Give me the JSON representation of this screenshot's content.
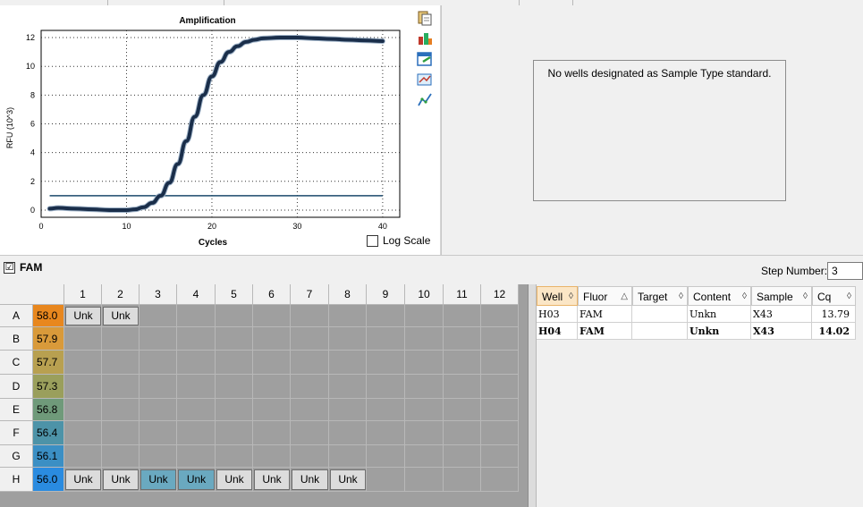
{
  "chart": {
    "title": "Amplification",
    "xlabel": "Cycles",
    "ylabel": "RFU (10^3)",
    "log_scale_label": "Log Scale"
  },
  "chart_data": {
    "type": "line",
    "title": "Amplification",
    "xlabel": "Cycles",
    "ylabel": "RFU (10^3)",
    "xlim": [
      0,
      42
    ],
    "ylim": [
      -0.5,
      12.5
    ],
    "xticks": [
      0,
      10,
      20,
      30,
      40
    ],
    "yticks": [
      0,
      2,
      4,
      6,
      8,
      10,
      12
    ],
    "grid": true,
    "threshold": 1.0,
    "series": [
      {
        "x": [
          1,
          2,
          4,
          6,
          8,
          10,
          11,
          12,
          13,
          14,
          15,
          16,
          17,
          18,
          19,
          20,
          21,
          22,
          23,
          24,
          25,
          26,
          28,
          30,
          32,
          34,
          36,
          38,
          40
        ],
        "y": [
          0.1,
          0.15,
          0.1,
          0.05,
          0.0,
          0.0,
          0.05,
          0.2,
          0.5,
          1.0,
          1.9,
          3.2,
          4.8,
          6.5,
          8.0,
          9.3,
          10.3,
          11.0,
          11.4,
          11.7,
          11.85,
          11.95,
          12.0,
          12.0,
          11.95,
          11.9,
          11.85,
          11.8,
          11.75
        ],
        "color": "#1a2e4a"
      }
    ]
  },
  "standard_curve": {
    "message": "No wells designated as Sample Type standard."
  },
  "fluor_bar": {
    "check": "☑",
    "label": "FAM",
    "step_label": "Step Number:",
    "step_value": "3"
  },
  "plate": {
    "columns": [
      "1",
      "2",
      "3",
      "4",
      "5",
      "6",
      "7",
      "8",
      "9",
      "10",
      "11",
      "12"
    ],
    "rows": [
      "A",
      "B",
      "C",
      "D",
      "E",
      "F",
      "G",
      "H"
    ],
    "gradient": [
      "58.0",
      "57.9",
      "57.7",
      "57.3",
      "56.8",
      "56.4",
      "56.1",
      "56.0"
    ],
    "gradient_colors": [
      "#e8871e",
      "#d99a3a",
      "#b8a050",
      "#9a9f5c",
      "#6f9a7a",
      "#4d93a8",
      "#3b8fc4",
      "#2a8be0"
    ],
    "wells": [
      {
        "row": 0,
        "col": 0,
        "label": "Unk",
        "highlight": false
      },
      {
        "row": 0,
        "col": 1,
        "label": "Unk",
        "highlight": false
      },
      {
        "row": 7,
        "col": 0,
        "label": "Unk",
        "highlight": false
      },
      {
        "row": 7,
        "col": 1,
        "label": "Unk",
        "highlight": false
      },
      {
        "row": 7,
        "col": 2,
        "label": "Unk",
        "highlight": true
      },
      {
        "row": 7,
        "col": 3,
        "label": "Unk",
        "highlight": true
      },
      {
        "row": 7,
        "col": 4,
        "label": "Unk",
        "highlight": false
      },
      {
        "row": 7,
        "col": 5,
        "label": "Unk",
        "highlight": false
      },
      {
        "row": 7,
        "col": 6,
        "label": "Unk",
        "highlight": false
      },
      {
        "row": 7,
        "col": 7,
        "label": "Unk",
        "highlight": false
      }
    ]
  },
  "results": {
    "columns": [
      {
        "label": "Well",
        "sort": "◊"
      },
      {
        "label": "Fluor",
        "sort": "△"
      },
      {
        "label": "Target",
        "sort": "◊"
      },
      {
        "label": "Content",
        "sort": "◊"
      },
      {
        "label": "Sample",
        "sort": "◊"
      },
      {
        "label": "Cq",
        "sort": "◊"
      }
    ],
    "rows": [
      {
        "cells": [
          "H03",
          "FAM",
          "",
          "Unkn",
          "X43",
          "13.79"
        ],
        "bold": false
      },
      {
        "cells": [
          "H04",
          "FAM",
          "",
          "Unkn",
          "X43",
          "14.02"
        ],
        "bold": true
      }
    ]
  },
  "toolbar": {
    "icons": [
      "copy-icon",
      "export-icon",
      "save-image-icon",
      "zoom-icon",
      "chart-settings-icon"
    ]
  }
}
